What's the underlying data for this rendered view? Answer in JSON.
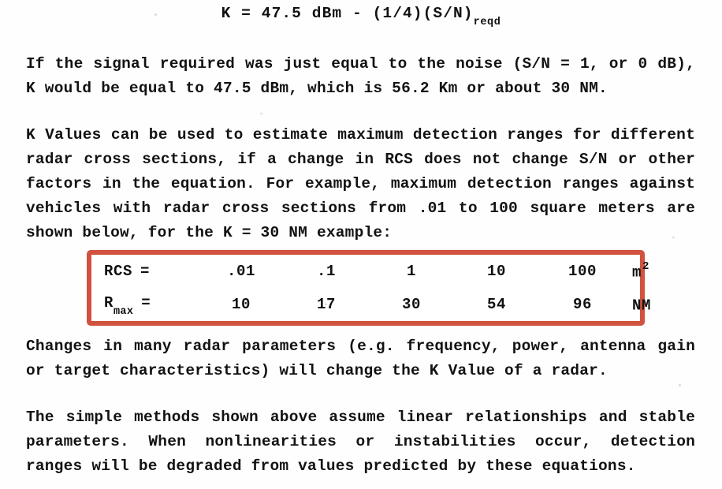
{
  "document": {
    "equation": {
      "main": "K = 47.5 dBm - (1/4)(S/N)",
      "subscript": "reqd"
    },
    "paragraphs": [
      {
        "id": "para-1",
        "lines": [
          "If the signal required was just equal to the noise (S/N = 1, or 0 dB),",
          "K would be equal to 47.5 dBm, which is 56.2 Km or about 30 NM."
        ]
      },
      {
        "id": "para-2",
        "lines": [
          "K Values can be used to estimate maximum detection ranges for different",
          "radar cross sections, if a change in RCS does not change S/N or other",
          "factors in the equation. For example, maximum detection ranges against",
          "vehicles with radar cross sections from .01 to 100 square meters are",
          "shown below, for the K = 30 NM example:"
        ]
      },
      {
        "id": "para-3",
        "lines": [
          "Changes in many radar parameters (e.g. frequency, power, antenna gain",
          "or target characteristics) will change the K Value of a radar."
        ]
      },
      {
        "id": "para-4",
        "lines": [
          "The simple methods shown above assume linear relationships and stable",
          "parameters. When nonlinearities or instabilities occur, detection",
          "ranges will be degraded from values predicted by these equations."
        ]
      }
    ],
    "rcs_table": {
      "highlight_color": "#d0523f",
      "rows": [
        {
          "label": "RCS",
          "label_subscript": "",
          "equals": "=",
          "values": [
            ".01",
            ".1",
            "1",
            "10",
            "100"
          ],
          "unit": "m",
          "unit_superscript": "2"
        },
        {
          "label": "R",
          "label_subscript": "max",
          "equals": "=",
          "values": [
            "10",
            "17",
            "30",
            "54",
            "96"
          ],
          "unit": "NM",
          "unit_superscript": ""
        }
      ]
    }
  }
}
